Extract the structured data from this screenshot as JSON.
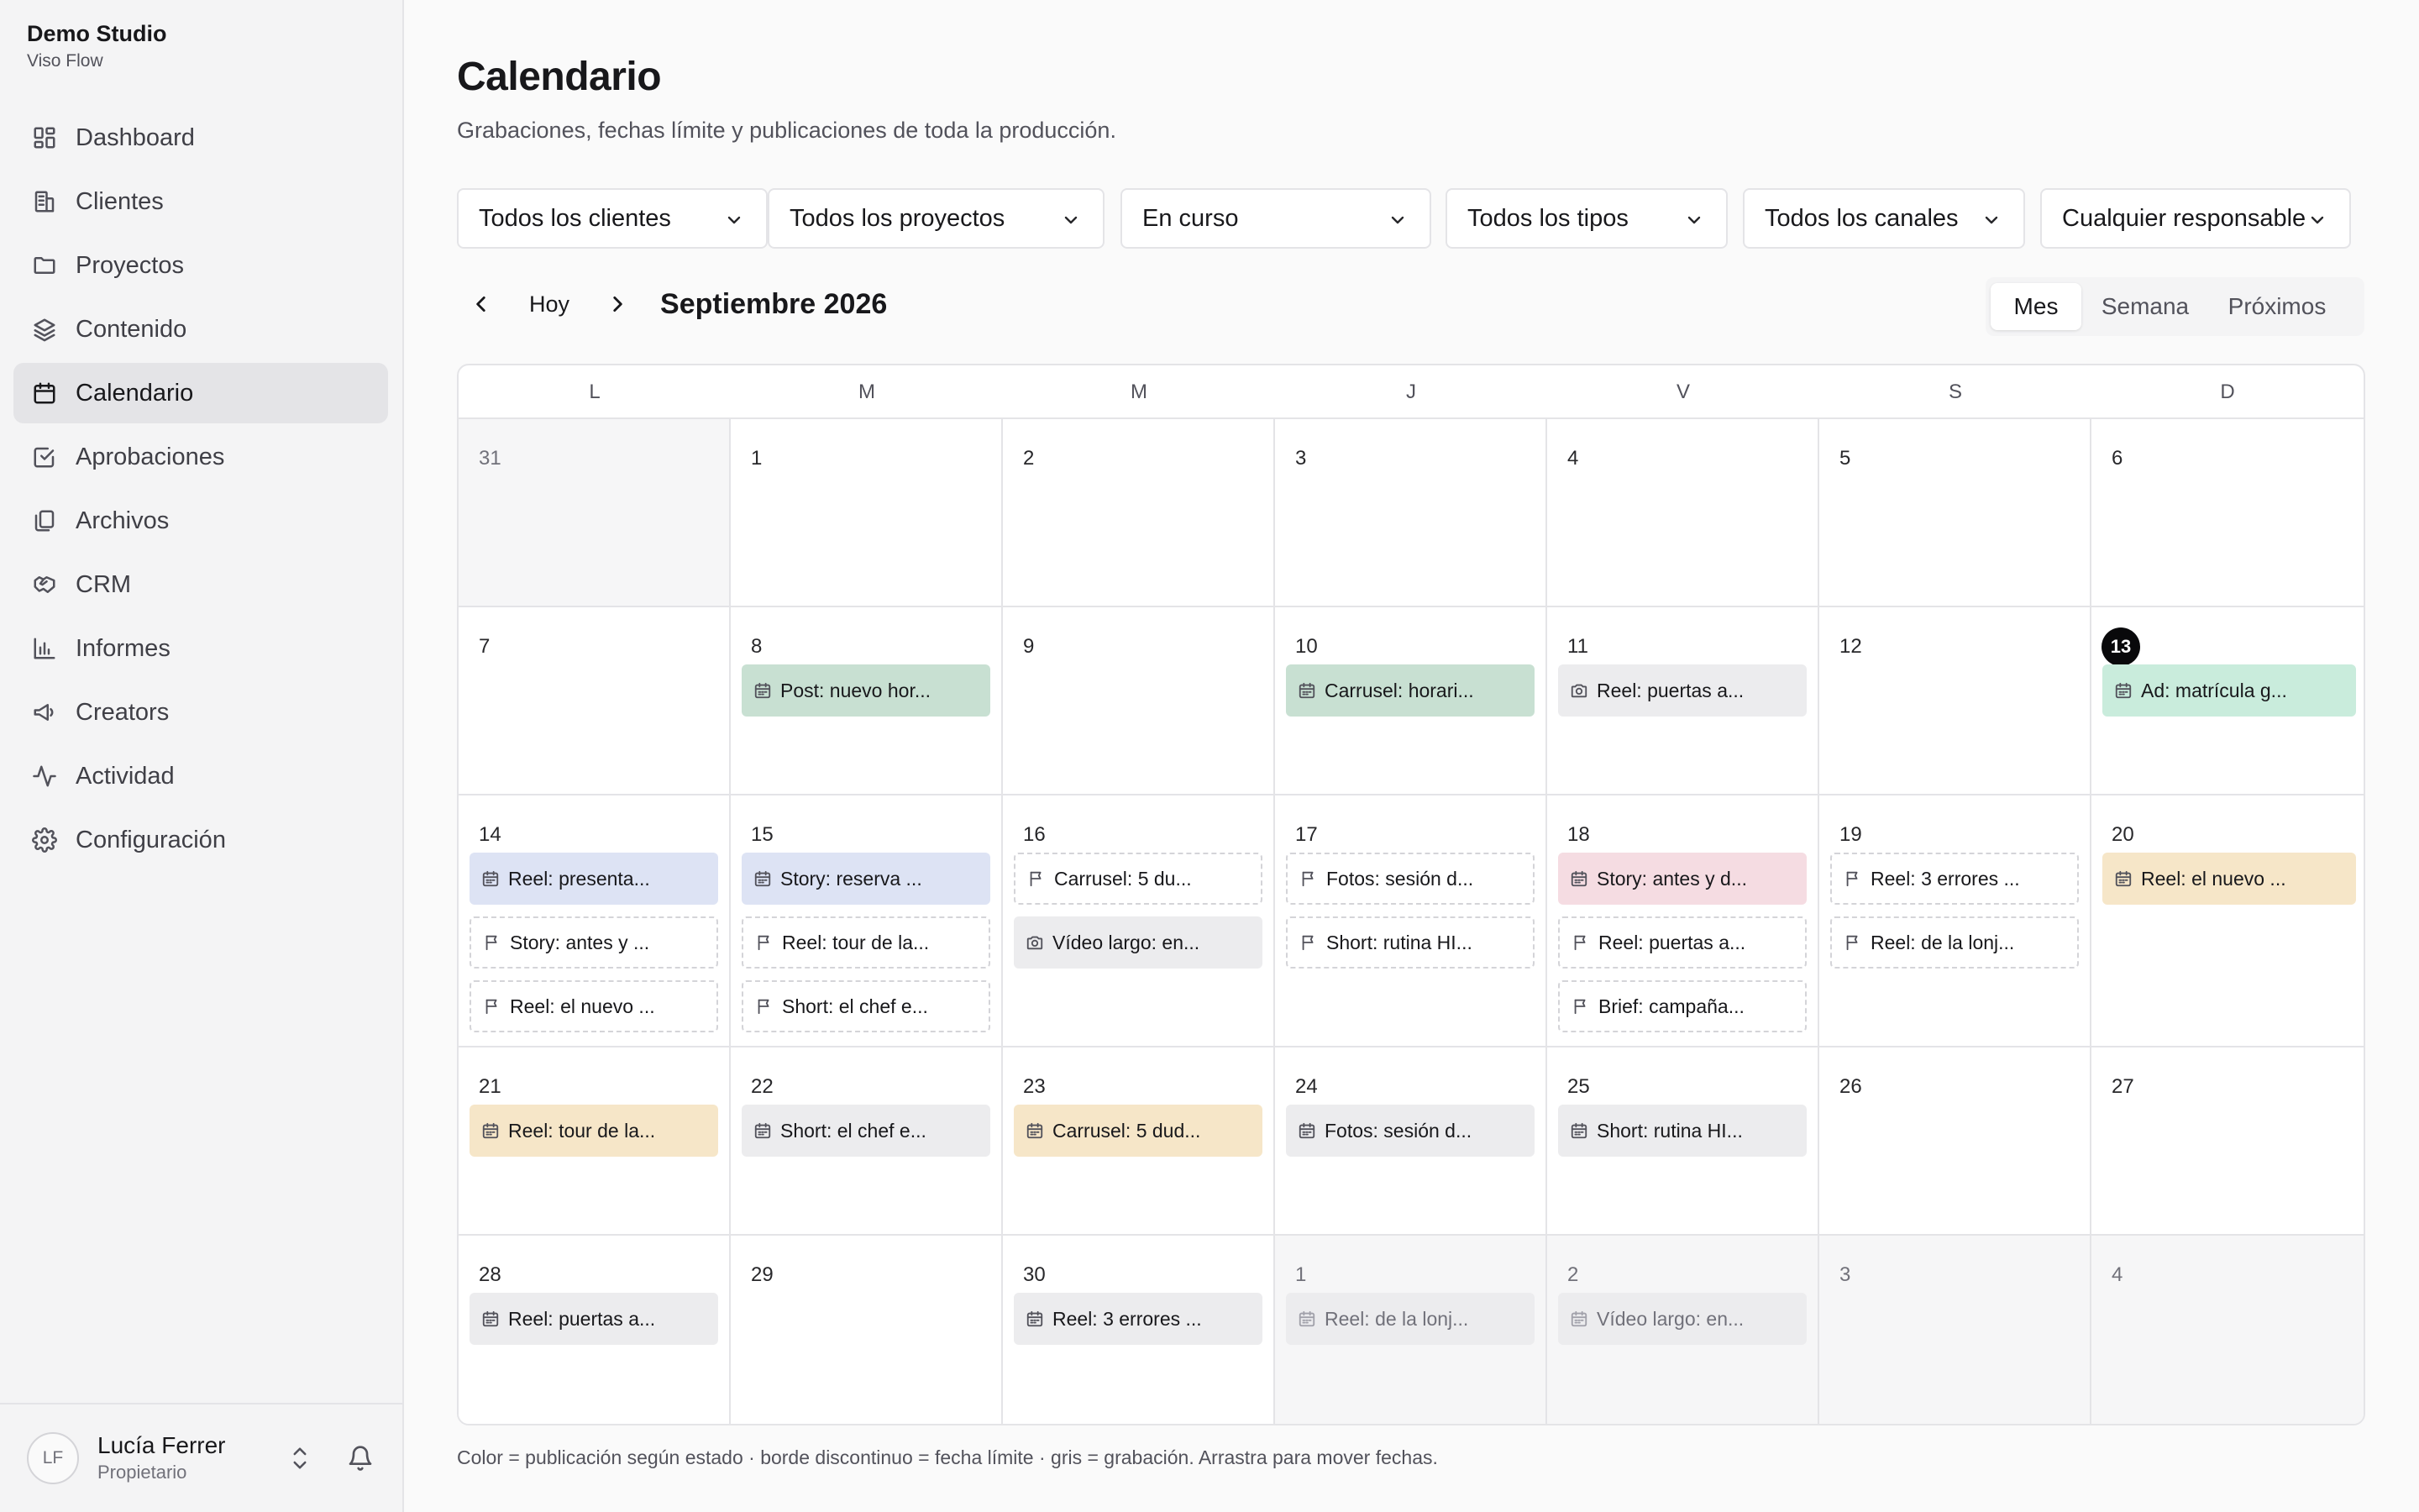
{
  "brand": {
    "name": "Demo Studio",
    "subtitle": "Viso Flow"
  },
  "nav": [
    {
      "label": "Dashboard",
      "icon": "dashboard-icon",
      "active": false
    },
    {
      "label": "Clientes",
      "icon": "building-icon",
      "active": false
    },
    {
      "label": "Proyectos",
      "icon": "folder-icon",
      "active": false
    },
    {
      "label": "Contenido",
      "icon": "layers-icon",
      "active": false
    },
    {
      "label": "Calendario",
      "icon": "calendar-icon",
      "active": true
    },
    {
      "label": "Aprobaciones",
      "icon": "check-square-icon",
      "active": false
    },
    {
      "label": "Archivos",
      "icon": "files-icon",
      "active": false
    },
    {
      "label": "CRM",
      "icon": "handshake-icon",
      "active": false
    },
    {
      "label": "Informes",
      "icon": "bar-chart-icon",
      "active": false
    },
    {
      "label": "Creators",
      "icon": "megaphone-icon",
      "active": false
    },
    {
      "label": "Actividad",
      "icon": "activity-icon",
      "active": false
    },
    {
      "label": "Configuración",
      "icon": "gear-icon",
      "active": false
    }
  ],
  "user": {
    "initials": "LF",
    "name": "Lucía Ferrer",
    "role": "Propietario"
  },
  "page": {
    "title": "Calendario",
    "subtitle": "Grabaciones, fechas límite y publicaciones de toda la producción."
  },
  "filters": [
    "Todos los clientes",
    "Todos los proyectos",
    "En curso",
    "Todos los tipos",
    "Todos los canales",
    "Cualquier responsable"
  ],
  "calnav": {
    "today": "Hoy",
    "month": "Septiembre 2026"
  },
  "views": [
    {
      "label": "Mes",
      "active": true
    },
    {
      "label": "Semana",
      "active": false
    },
    {
      "label": "Próximos",
      "active": false
    }
  ],
  "weekdays": [
    "L",
    "M",
    "M",
    "J",
    "V",
    "S",
    "D"
  ],
  "today_day": 13,
  "weeks": [
    [
      {
        "day": "31",
        "out": true,
        "events": []
      },
      {
        "day": "1",
        "out": false,
        "events": []
      },
      {
        "day": "2",
        "out": false,
        "events": []
      },
      {
        "day": "3",
        "out": false,
        "events": []
      },
      {
        "day": "4",
        "out": false,
        "events": []
      },
      {
        "day": "5",
        "out": false,
        "events": []
      },
      {
        "day": "6",
        "out": false,
        "events": []
      }
    ],
    [
      {
        "day": "7",
        "out": false,
        "events": []
      },
      {
        "day": "8",
        "out": false,
        "events": [
          {
            "label": "Post: nuevo hor...",
            "kind": "publish",
            "color": "green"
          }
        ]
      },
      {
        "day": "9",
        "out": false,
        "events": []
      },
      {
        "day": "10",
        "out": false,
        "events": [
          {
            "label": "Carrusel: horari...",
            "kind": "publish",
            "color": "green"
          }
        ]
      },
      {
        "day": "11",
        "out": false,
        "events": [
          {
            "label": "Reel: puertas a...",
            "kind": "shoot",
            "color": "gray"
          }
        ]
      },
      {
        "day": "12",
        "out": false,
        "events": []
      },
      {
        "day": "13",
        "out": false,
        "today": true,
        "events": [
          {
            "label": "Ad: matrícula g...",
            "kind": "publish",
            "color": "mint"
          }
        ]
      }
    ],
    [
      {
        "day": "14",
        "out": false,
        "events": [
          {
            "label": "Reel: presenta...",
            "kind": "publish",
            "color": "blue"
          },
          {
            "label": "Story: antes y ...",
            "kind": "deadline",
            "color": "none"
          },
          {
            "label": "Reel: el nuevo ...",
            "kind": "deadline",
            "color": "none"
          }
        ]
      },
      {
        "day": "15",
        "out": false,
        "events": [
          {
            "label": "Story: reserva ...",
            "kind": "publish",
            "color": "blue"
          },
          {
            "label": "Reel: tour de la...",
            "kind": "deadline",
            "color": "none"
          },
          {
            "label": "Short: el chef e...",
            "kind": "deadline",
            "color": "none"
          }
        ]
      },
      {
        "day": "16",
        "out": false,
        "events": [
          {
            "label": "Carrusel: 5 du...",
            "kind": "deadline",
            "color": "none"
          },
          {
            "label": "Vídeo largo: en...",
            "kind": "shoot",
            "color": "gray"
          }
        ]
      },
      {
        "day": "17",
        "out": false,
        "events": [
          {
            "label": "Fotos: sesión d...",
            "kind": "deadline",
            "color": "none"
          },
          {
            "label": "Short: rutina HI...",
            "kind": "deadline",
            "color": "none"
          }
        ]
      },
      {
        "day": "18",
        "out": false,
        "events": [
          {
            "label": "Story: antes y d...",
            "kind": "publish",
            "color": "pink"
          },
          {
            "label": "Reel: puertas a...",
            "kind": "deadline",
            "color": "none"
          },
          {
            "label": "Brief: campaña...",
            "kind": "deadline",
            "color": "none"
          }
        ]
      },
      {
        "day": "19",
        "out": false,
        "events": [
          {
            "label": "Reel: 3 errores ...",
            "kind": "deadline",
            "color": "none"
          },
          {
            "label": "Reel: de la lonj...",
            "kind": "deadline",
            "color": "none"
          }
        ]
      },
      {
        "day": "20",
        "out": false,
        "events": [
          {
            "label": "Reel: el nuevo ...",
            "kind": "publish",
            "color": "amber"
          }
        ]
      }
    ],
    [
      {
        "day": "21",
        "out": false,
        "events": [
          {
            "label": "Reel: tour de la...",
            "kind": "publish",
            "color": "amber"
          }
        ]
      },
      {
        "day": "22",
        "out": false,
        "events": [
          {
            "label": "Short: el chef e...",
            "kind": "publish",
            "color": "gray"
          }
        ]
      },
      {
        "day": "23",
        "out": false,
        "events": [
          {
            "label": "Carrusel: 5 dud...",
            "kind": "publish",
            "color": "amber"
          }
        ]
      },
      {
        "day": "24",
        "out": false,
        "events": [
          {
            "label": "Fotos: sesión d...",
            "kind": "publish",
            "color": "gray"
          }
        ]
      },
      {
        "day": "25",
        "out": false,
        "events": [
          {
            "label": "Short: rutina HI...",
            "kind": "publish",
            "color": "gray"
          }
        ]
      },
      {
        "day": "26",
        "out": false,
        "events": []
      },
      {
        "day": "27",
        "out": false,
        "events": []
      }
    ],
    [
      {
        "day": "28",
        "out": false,
        "events": [
          {
            "label": "Reel: puertas a...",
            "kind": "publish",
            "color": "gray"
          }
        ]
      },
      {
        "day": "29",
        "out": false,
        "events": []
      },
      {
        "day": "30",
        "out": false,
        "events": [
          {
            "label": "Reel: 3 errores ...",
            "kind": "publish",
            "color": "gray"
          }
        ]
      },
      {
        "day": "1",
        "out": true,
        "events": [
          {
            "label": "Reel: de la lonj...",
            "kind": "publish",
            "color": "faded"
          }
        ]
      },
      {
        "day": "2",
        "out": true,
        "events": [
          {
            "label": "Vídeo largo: en...",
            "kind": "publish",
            "color": "faded"
          }
        ]
      },
      {
        "day": "3",
        "out": true,
        "events": []
      },
      {
        "day": "4",
        "out": true,
        "events": []
      }
    ]
  ],
  "legend": "Color = publicación según estado · borde discontinuo = fecha límite · gris = grabación. Arrastra para mover fechas."
}
